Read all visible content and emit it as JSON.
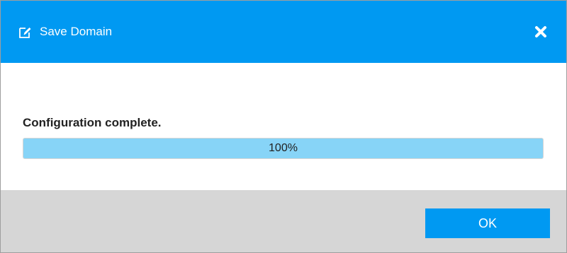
{
  "dialog": {
    "title": "Save Domain",
    "title_icon": "edit-icon",
    "close_icon": "close-icon",
    "accent_color": "#0099f2"
  },
  "body": {
    "status_text": "Configuration complete.",
    "progress": {
      "percent": 100,
      "label": "100%",
      "fill_color": "#87d4f7"
    }
  },
  "footer": {
    "ok_label": "OK"
  }
}
